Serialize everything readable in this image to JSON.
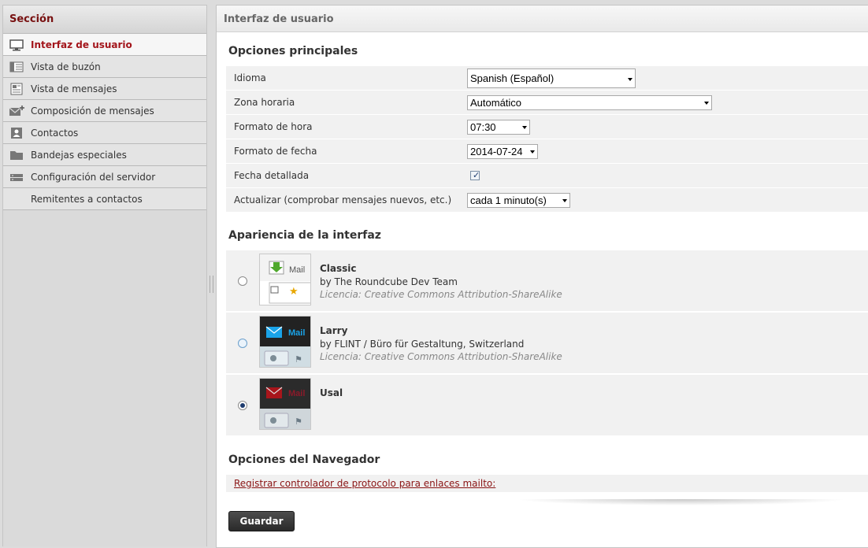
{
  "sidebar": {
    "title": "Sección",
    "items": [
      {
        "label": "Interfaz de usuario",
        "icon": "monitor-icon",
        "active": true
      },
      {
        "label": "Vista de buzón",
        "icon": "mailbox-view-icon"
      },
      {
        "label": "Vista de mensajes",
        "icon": "message-view-icon"
      },
      {
        "label": "Composición de mensajes",
        "icon": "compose-icon"
      },
      {
        "label": "Contactos",
        "icon": "contacts-icon"
      },
      {
        "label": "Bandejas especiales",
        "icon": "folder-icon"
      },
      {
        "label": "Configuración del servidor",
        "icon": "server-icon"
      },
      {
        "label": "Remitentes a contactos",
        "icon": ""
      }
    ]
  },
  "main": {
    "title": "Interfaz de usuario",
    "sections": {
      "main_options": "Opciones principales",
      "appearance": "Apariencia de la interfaz",
      "browser": "Opciones del Navegador"
    },
    "options": [
      {
        "label": "Idioma",
        "value": "Spanish (Español)",
        "type": "select"
      },
      {
        "label": "Zona horaria",
        "value": "Automático",
        "type": "select"
      },
      {
        "label": "Formato de hora",
        "value": "07:30",
        "type": "select"
      },
      {
        "label": "Formato de fecha",
        "value": "2014-07-24",
        "type": "select"
      },
      {
        "label": "Fecha detallada",
        "checked": true,
        "type": "checkbox"
      },
      {
        "label": "Actualizar (comprobar mensajes nuevos, etc.)",
        "value": "cada 1 minuto(s)",
        "type": "select"
      }
    ],
    "skins": [
      {
        "name": "Classic",
        "author": "by The Roundcube Dev Team",
        "license": "Licencia: Creative Commons Attribution-ShareAlike",
        "selected": false,
        "thumb_text": "Mail"
      },
      {
        "name": "Larry",
        "author": "by FLINT / Büro für Gestaltung, Switzerland",
        "license": "Licencia: Creative Commons Attribution-ShareAlike",
        "selected": false,
        "thumb_text": "Mail"
      },
      {
        "name": "Usal",
        "author": "",
        "license": "",
        "selected": true,
        "thumb_text": "Mail"
      }
    ],
    "protocol_link": "Registrar controlador de protocolo para enlaces mailto:",
    "save_label": "Guardar"
  },
  "colors": {
    "accent": "#a3151b",
    "sidebar_bg": "#dadada",
    "button_bg": "#333333"
  }
}
